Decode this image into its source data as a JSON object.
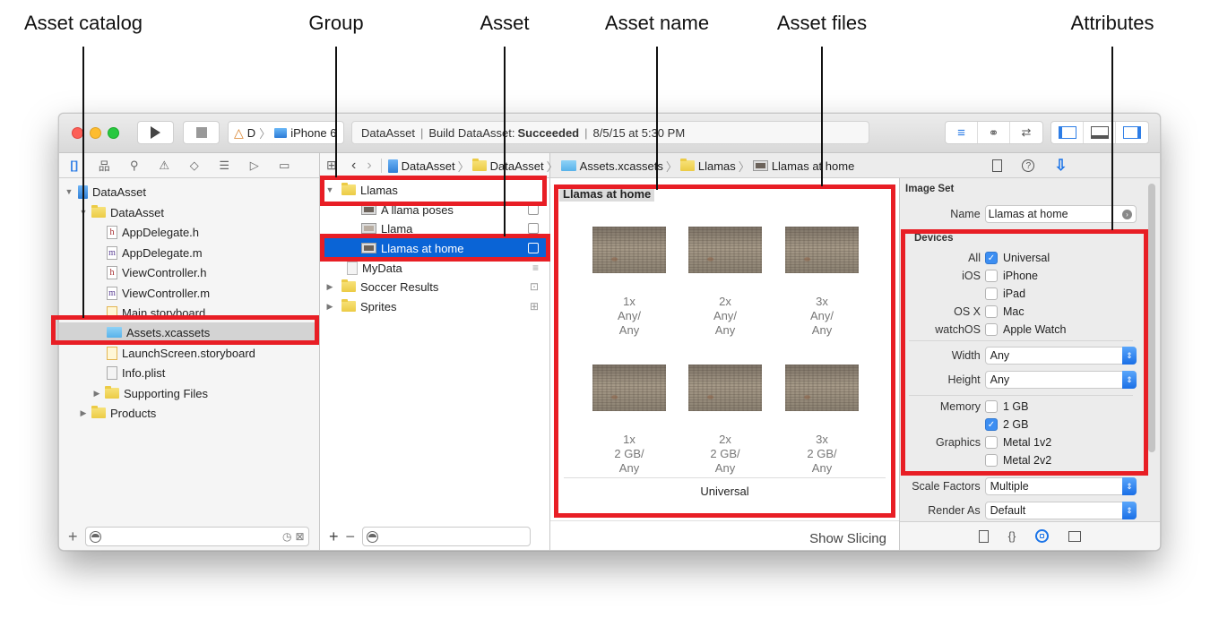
{
  "callouts": [
    {
      "label": "Asset catalog"
    },
    {
      "label": "Group"
    },
    {
      "label": "Asset"
    },
    {
      "label": "Asset name"
    },
    {
      "label": "Asset files"
    },
    {
      "label": "Attributes"
    }
  ],
  "toolbar": {
    "scheme": "D",
    "device": "iPhone 6",
    "activity": {
      "project": "DataAsset",
      "build_prefix": "Build DataAsset:",
      "build_status": "Succeeded",
      "timestamp": "8/5/15 at 5:30 PM"
    }
  },
  "navigator": {
    "tree": [
      {
        "label": "DataAsset",
        "icon": "project-icon"
      },
      {
        "label": "DataAsset",
        "icon": "folder-icon"
      },
      {
        "label": "AppDelegate.h",
        "icon": "header-file-icon",
        "glyph": "h"
      },
      {
        "label": "AppDelegate.m",
        "icon": "source-file-icon",
        "glyph": "m"
      },
      {
        "label": "ViewController.h",
        "icon": "header-file-icon",
        "glyph": "h"
      },
      {
        "label": "ViewController.m",
        "icon": "source-file-icon",
        "glyph": "m"
      },
      {
        "label": "Main.storyboard",
        "icon": "storyboard-icon"
      },
      {
        "label": "Assets.xcassets",
        "icon": "asset-catalog-icon",
        "selected": true
      },
      {
        "label": "LaunchScreen.storyboard",
        "icon": "storyboard-icon"
      },
      {
        "label": "Info.plist",
        "icon": "plist-icon"
      },
      {
        "label": "Supporting Files",
        "icon": "folder-icon"
      },
      {
        "label": "Products",
        "icon": "folder-icon"
      }
    ]
  },
  "jumpbar": {
    "crumbs": [
      "DataAsset",
      "DataAsset",
      "Assets.xcassets",
      "Llamas",
      "Llamas at home"
    ]
  },
  "outline": {
    "items": [
      {
        "label": "Llamas"
      },
      {
        "label": "A llama poses"
      },
      {
        "label": "Llama"
      },
      {
        "label": "Llamas at home",
        "selected": true
      },
      {
        "label": "MyData"
      },
      {
        "label": "Soccer Results"
      },
      {
        "label": "Sprites"
      }
    ]
  },
  "editor": {
    "asset_name": "Llamas at home",
    "slots_row1": [
      {
        "scale": "1x",
        "line2": "Any/",
        "line3": "Any"
      },
      {
        "scale": "2x",
        "line2": "Any/",
        "line3": "Any"
      },
      {
        "scale": "3x",
        "line2": "Any/",
        "line3": "Any"
      }
    ],
    "slots_row2": [
      {
        "scale": "1x",
        "line2": "2 GB/",
        "line3": "Any"
      },
      {
        "scale": "2x",
        "line2": "2 GB/",
        "line3": "Any"
      },
      {
        "scale": "3x",
        "line2": "2 GB/",
        "line3": "Any"
      }
    ],
    "device_label": "Universal",
    "show_slicing": "Show Slicing"
  },
  "inspector": {
    "section_title": "Image Set",
    "name_label": "Name",
    "name_value": "Llamas at home",
    "devices_title": "Devices",
    "devices": [
      {
        "group": "All",
        "label": "Universal",
        "checked": true
      },
      {
        "group": "iOS",
        "label": "iPhone",
        "checked": false
      },
      {
        "group": "",
        "label": "iPad",
        "checked": false
      },
      {
        "group": "OS X",
        "label": "Mac",
        "checked": false
      },
      {
        "group": "watchOS",
        "label": "Apple Watch",
        "checked": false
      }
    ],
    "width_label": "Width",
    "width_value": "Any",
    "height_label": "Height",
    "height_value": "Any",
    "memory": [
      {
        "group": "Memory",
        "label": "1 GB",
        "checked": false
      },
      {
        "group": "",
        "label": "2 GB",
        "checked": true
      }
    ],
    "graphics": [
      {
        "group": "Graphics",
        "label": "Metal 1v2",
        "checked": false
      },
      {
        "group": "",
        "label": "Metal 2v2",
        "checked": false
      }
    ],
    "scale_label": "Scale Factors",
    "scale_value": "Multiple",
    "render_label": "Render As",
    "render_value": "Default"
  },
  "colors": {
    "highlight": "#e81e25",
    "selection": "#0a64d6",
    "accent": "#3c8ef2"
  }
}
